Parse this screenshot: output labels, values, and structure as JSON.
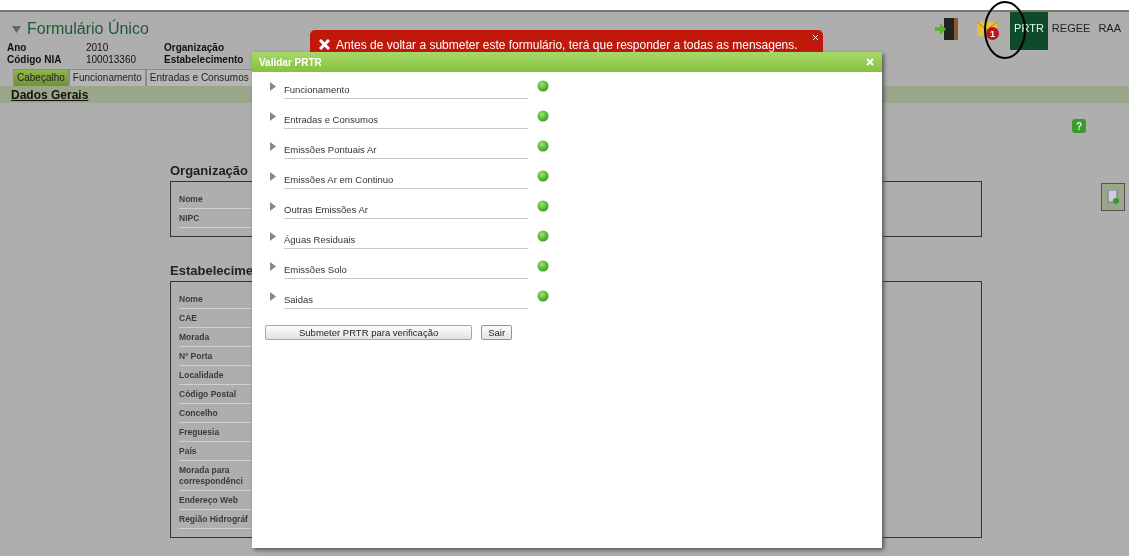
{
  "header": {
    "title": "Formulário Único",
    "info": [
      {
        "label": "Ano",
        "value": "2010",
        "label_2": "Organização"
      },
      {
        "label": "Código NIA",
        "value": "100013360",
        "label_2": "Estabelecimento"
      }
    ]
  },
  "top_nav": {
    "message_badge": "1",
    "links": [
      {
        "label": "PRTR",
        "selected": true
      },
      {
        "label": "REGEE",
        "selected": false
      },
      {
        "label": "RAA",
        "selected": false
      }
    ]
  },
  "tabs": [
    {
      "label": "Cabeçalho",
      "selected": true
    },
    {
      "label": "Funcionamento",
      "selected": false
    },
    {
      "label": "Entradas e Consumos",
      "selected": false
    }
  ],
  "section_title": "Dados Gerais",
  "help": "?",
  "groups": [
    {
      "title": "Organização",
      "fields": [
        "Nome",
        "NIPC"
      ]
    },
    {
      "title": "Estabelecime",
      "fields": [
        "Nome",
        "CAE",
        "Morada",
        "Nº Porta",
        "Localidade",
        "Código Postal",
        "Concelho",
        "Freguesia",
        "País",
        "Morada para correspondênci",
        "Endereço Web",
        "Região Hidrográf"
      ]
    }
  ],
  "toast": {
    "message": "Antes de voltar a submeter este formulário, terá que responder a todas as mensagens."
  },
  "dialog": {
    "title": "Validar PRTR",
    "items": [
      {
        "label": "Funcionamento",
        "valid": true
      },
      {
        "label": "Entradas e Consumos",
        "valid": true
      },
      {
        "label": "Emissões Pontuais Ar",
        "valid": true
      },
      {
        "label": "Emissões Ar em Continuo",
        "valid": true
      },
      {
        "label": "Outras Emissões Ar",
        "valid": true
      },
      {
        "label": "Águas Residuais",
        "valid": true
      },
      {
        "label": "Emissões Solo",
        "valid": true
      },
      {
        "label": "Saidas",
        "valid": true
      }
    ],
    "buttons": [
      "Submeter PRTR para verificação",
      "Sair"
    ]
  }
}
